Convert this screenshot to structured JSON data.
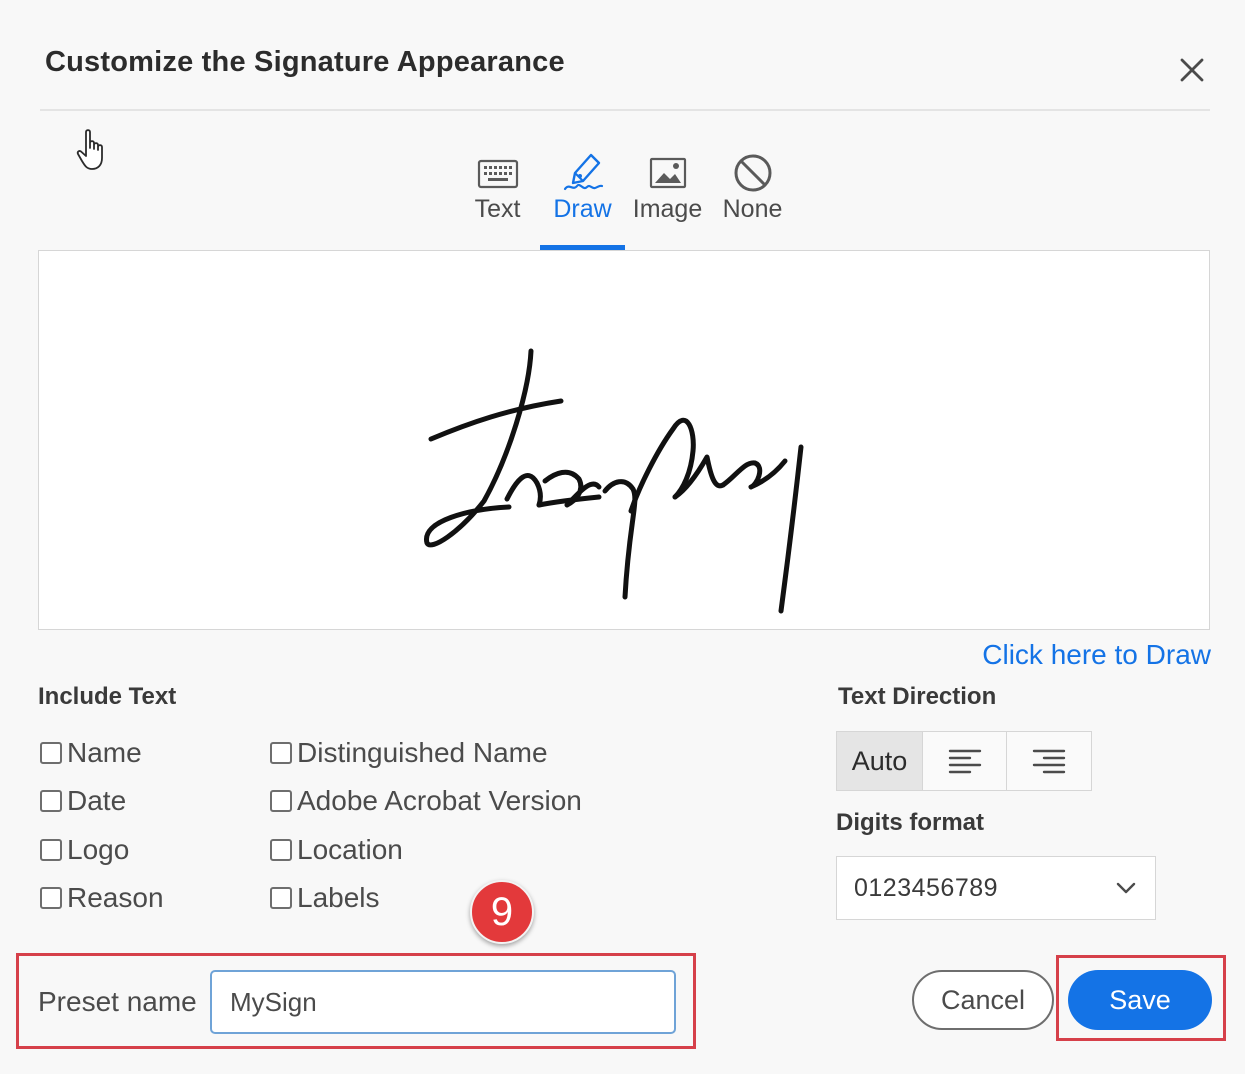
{
  "dialog": {
    "title": "Customize the Signature Appearance",
    "close_icon": "close-icon"
  },
  "tabs": [
    {
      "label": "Text",
      "icon": "keyboard-icon",
      "active": false
    },
    {
      "label": "Draw",
      "icon": "pen-icon",
      "active": true
    },
    {
      "label": "Image",
      "icon": "image-icon",
      "active": false
    },
    {
      "label": "None",
      "icon": "none-icon",
      "active": false
    }
  ],
  "canvas": {
    "signature": "handwritten-signature-drawing",
    "click_to_draw": "Click here to Draw"
  },
  "include_text": {
    "title": "Include Text",
    "options": [
      {
        "label": "Name",
        "checked": false
      },
      {
        "label": "Date",
        "checked": false
      },
      {
        "label": "Logo",
        "checked": false
      },
      {
        "label": "Reason",
        "checked": false
      },
      {
        "label": "Distinguished Name",
        "checked": false
      },
      {
        "label": "Adobe Acrobat Version",
        "checked": false
      },
      {
        "label": "Location",
        "checked": false
      },
      {
        "label": "Labels",
        "checked": false
      }
    ]
  },
  "text_direction": {
    "title": "Text Direction",
    "auto_label": "Auto",
    "selected": "Auto",
    "icons": [
      "align-left-icon",
      "align-right-icon"
    ]
  },
  "digits_format": {
    "title": "Digits format",
    "selected": "0123456789"
  },
  "step_badge": "9",
  "preset": {
    "label": "Preset name",
    "value": "MySign"
  },
  "buttons": {
    "cancel": "Cancel",
    "save": "Save"
  },
  "colors": {
    "accent": "#1473e6",
    "highlight": "#d6404a",
    "badge": "#e3393b"
  }
}
